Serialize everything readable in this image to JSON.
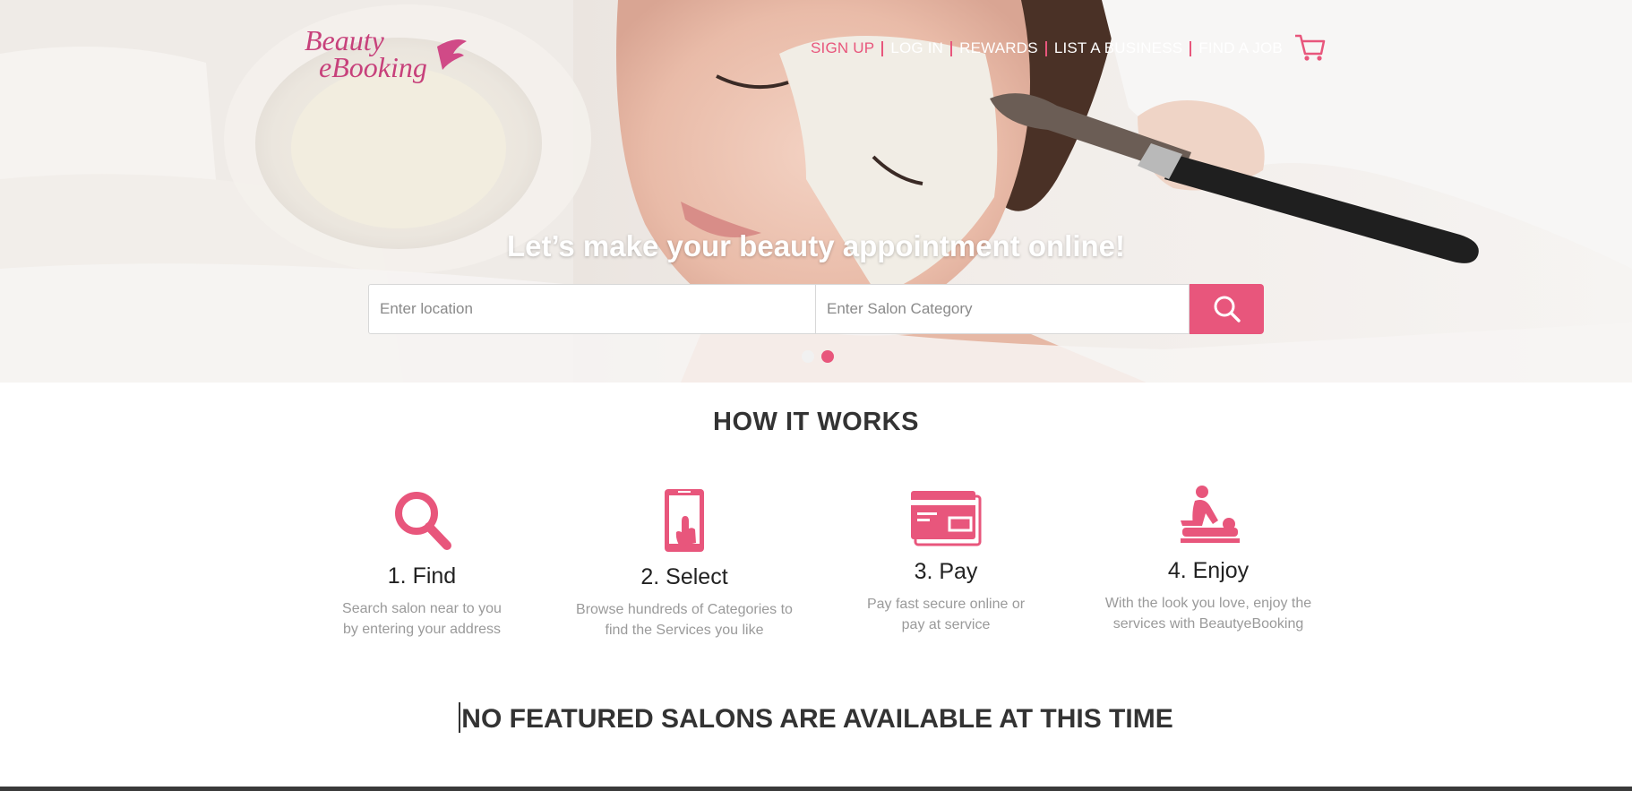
{
  "brand": {
    "logo_line1": "Beauty",
    "logo_line2": "eBooking"
  },
  "nav": {
    "sign_up": "SIGN UP",
    "log_in": "LOG IN",
    "rewards": "REWARDS",
    "list_business": "LIST A BUSINESS",
    "find_job": "FIND A JOB",
    "cart_icon": "cart-icon"
  },
  "hero": {
    "tagline": "Let’s make your beauty appointment online!",
    "location_placeholder": "Enter location",
    "category_placeholder": "Enter Salon Category",
    "search_icon": "search-icon",
    "slides": 2,
    "active_slide": 2
  },
  "how_it_works": {
    "title": "HOW IT WORKS",
    "steps": [
      {
        "title": "1. Find",
        "line1": "Search salon near to you",
        "line2": "by entering your address",
        "icon": "magnifier-icon"
      },
      {
        "title": "2. Select",
        "line1": "Browse hundreds of Categories to",
        "line2": "find the Services you like",
        "icon": "phone-tap-icon"
      },
      {
        "title": "3. Pay",
        "line1": "Pay fast secure online or",
        "line2": "pay at service",
        "icon": "credit-card-icon"
      },
      {
        "title": "4. Enjoy",
        "line1": "With the look you love, enjoy the",
        "line2": "services with BeautyeBooking",
        "icon": "massage-icon"
      }
    ]
  },
  "featured": {
    "message": "NO FEATURED SALONS ARE AVAILABLE AT THIS TIME"
  },
  "colors": {
    "accent": "#e8567c",
    "text": "#333333",
    "muted": "#9a9a9a"
  }
}
